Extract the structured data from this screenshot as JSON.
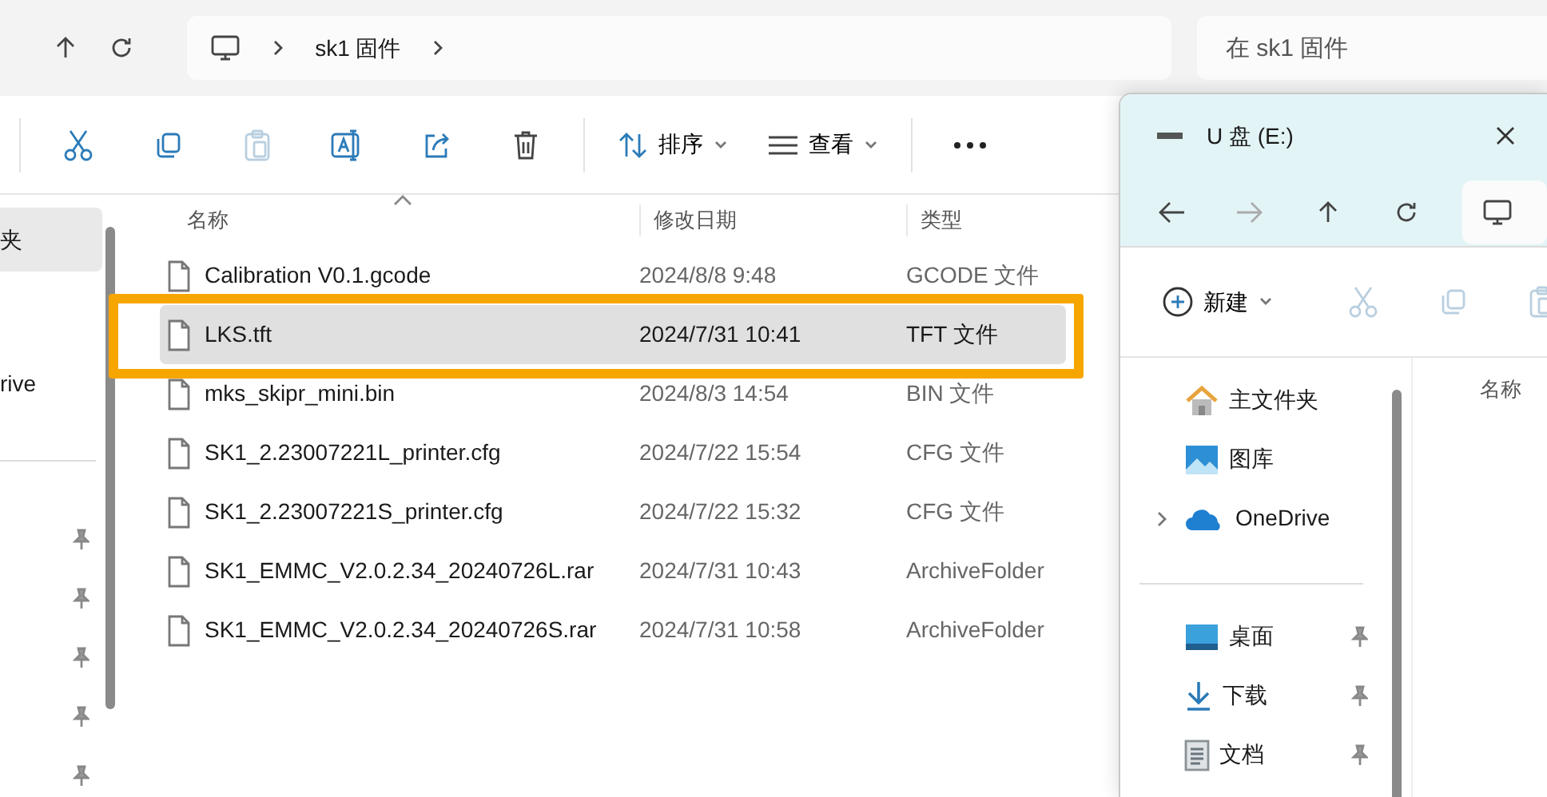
{
  "main_window": {
    "address": {
      "path": [
        "sk1 固件"
      ],
      "search_placeholder": "在 sk1 固件"
    },
    "toolbar": {
      "sort": "排序",
      "view": "查看"
    },
    "sidebar": [
      {
        "label": "夹",
        "selected": true
      },
      {
        "label": "rive",
        "selected": false
      }
    ],
    "columns": [
      "名称",
      "修改日期",
      "类型"
    ],
    "files": [
      {
        "name": "Calibration V0.1.gcode",
        "date": "2024/8/8 9:48",
        "type": "GCODE 文件",
        "selected": false,
        "annotated": false
      },
      {
        "name": "LKS.tft",
        "date": "2024/7/31 10:41",
        "type": "TFT 文件",
        "selected": true,
        "annotated": true
      },
      {
        "name": "mks_skipr_mini.bin",
        "date": "2024/8/3 14:54",
        "type": "BIN 文件",
        "selected": false,
        "annotated": false
      },
      {
        "name": "SK1_2.23007221L_printer.cfg",
        "date": "2024/7/22 15:54",
        "type": "CFG 文件",
        "selected": false,
        "annotated": false
      },
      {
        "name": "SK1_2.23007221S_printer.cfg",
        "date": "2024/7/22 15:32",
        "type": "CFG 文件",
        "selected": false,
        "annotated": false
      },
      {
        "name": "SK1_EMMC_V2.0.2.34_20240726L.rar",
        "date": "2024/7/31 10:43",
        "type": "ArchiveFolder",
        "selected": false,
        "annotated": false
      },
      {
        "name": "SK1_EMMC_V2.0.2.34_20240726S.rar",
        "date": "2024/7/31 10:58",
        "type": "ArchiveFolder",
        "selected": false,
        "annotated": false
      }
    ]
  },
  "second_window": {
    "title": "U 盘 (E:)",
    "toolbar": {
      "new": "新建"
    },
    "sidebar_groups": [
      [
        {
          "label": "主文件夹",
          "kind": "home",
          "pinned": false,
          "expandable": false
        },
        {
          "label": "图库",
          "kind": "gallery",
          "pinned": false,
          "expandable": false
        },
        {
          "label": "OneDrive",
          "kind": "cloud",
          "pinned": false,
          "expandable": true
        }
      ],
      [
        {
          "label": "桌面",
          "kind": "desktop",
          "pinned": true,
          "expandable": false
        },
        {
          "label": "下载",
          "kind": "download",
          "pinned": true,
          "expandable": false
        },
        {
          "label": "文档",
          "kind": "document",
          "pinned": true,
          "expandable": false
        }
      ]
    ],
    "columns": [
      "名称"
    ]
  }
}
